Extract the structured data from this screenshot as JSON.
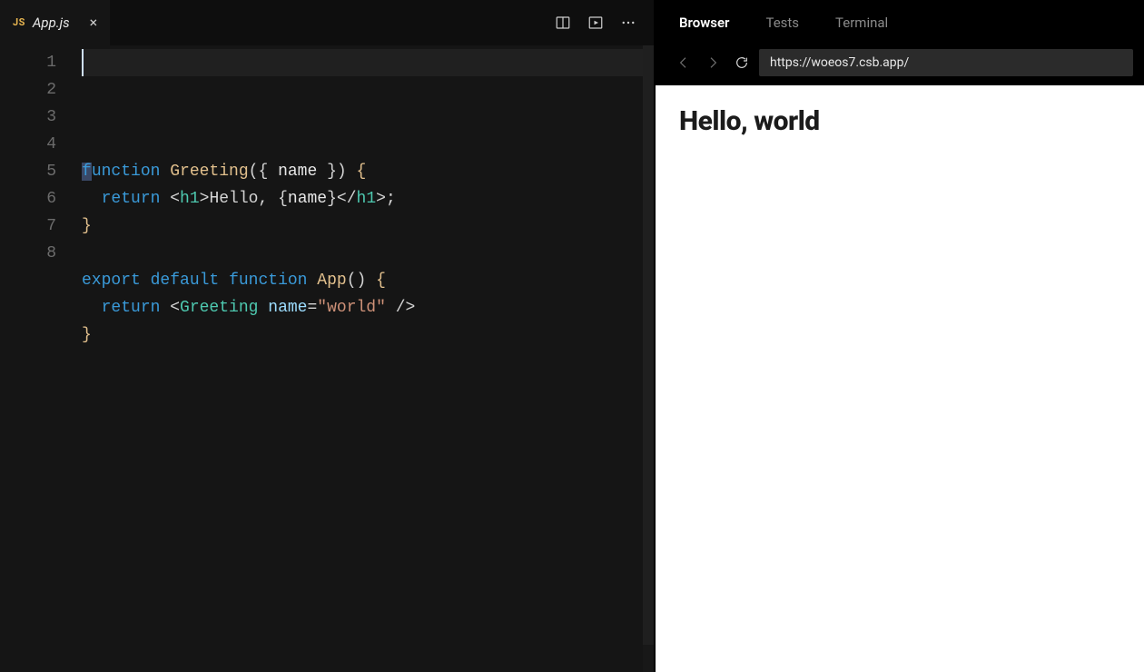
{
  "editor": {
    "tab": {
      "badge": "JS",
      "filename": "App.js"
    },
    "line_numbers": [
      "1",
      "2",
      "3",
      "4",
      "5",
      "6",
      "7",
      "8"
    ],
    "code_tokens": [
      [
        {
          "cls": "kw firstchar",
          "t": "f"
        },
        {
          "cls": "kw",
          "t": "unction"
        },
        {
          "cls": "pn",
          "t": " "
        },
        {
          "cls": "fn",
          "t": "Greeting"
        },
        {
          "cls": "pn",
          "t": "({ "
        },
        {
          "cls": "var",
          "t": "name"
        },
        {
          "cls": "pn",
          "t": " }) "
        },
        {
          "cls": "brace",
          "t": "{"
        }
      ],
      [
        {
          "cls": "pn",
          "t": "  "
        },
        {
          "cls": "kw",
          "t": "return"
        },
        {
          "cls": "pn",
          "t": " <"
        },
        {
          "cls": "tag",
          "t": "h1"
        },
        {
          "cls": "pn",
          "t": ">"
        },
        {
          "cls": "txt",
          "t": "Hello, "
        },
        {
          "cls": "pn",
          "t": "{"
        },
        {
          "cls": "var",
          "t": "name"
        },
        {
          "cls": "pn",
          "t": "}"
        },
        {
          "cls": "pn",
          "t": "</"
        },
        {
          "cls": "tag",
          "t": "h1"
        },
        {
          "cls": "pn",
          "t": ">;"
        }
      ],
      [
        {
          "cls": "brace",
          "t": "}"
        }
      ],
      [
        {
          "cls": "pn",
          "t": ""
        }
      ],
      [
        {
          "cls": "kw",
          "t": "export"
        },
        {
          "cls": "pn",
          "t": " "
        },
        {
          "cls": "kw",
          "t": "default"
        },
        {
          "cls": "pn",
          "t": " "
        },
        {
          "cls": "kw",
          "t": "function"
        },
        {
          "cls": "pn",
          "t": " "
        },
        {
          "cls": "fn",
          "t": "App"
        },
        {
          "cls": "pn",
          "t": "() "
        },
        {
          "cls": "brace",
          "t": "{"
        }
      ],
      [
        {
          "cls": "pn",
          "t": "  "
        },
        {
          "cls": "kw",
          "t": "return"
        },
        {
          "cls": "pn",
          "t": " <"
        },
        {
          "cls": "tag",
          "t": "Greeting"
        },
        {
          "cls": "pn",
          "t": " "
        },
        {
          "cls": "attr",
          "t": "name"
        },
        {
          "cls": "pn",
          "t": "="
        },
        {
          "cls": "str",
          "t": "\"world\""
        },
        {
          "cls": "pn",
          "t": " />"
        }
      ],
      [
        {
          "cls": "brace",
          "t": "}"
        }
      ],
      [
        {
          "cls": "pn",
          "t": ""
        }
      ]
    ]
  },
  "preview": {
    "tabs": {
      "browser": "Browser",
      "tests": "Tests",
      "terminal": "Terminal"
    },
    "url": "https://woeos7.csb.app/",
    "page_heading": "Hello, world"
  }
}
